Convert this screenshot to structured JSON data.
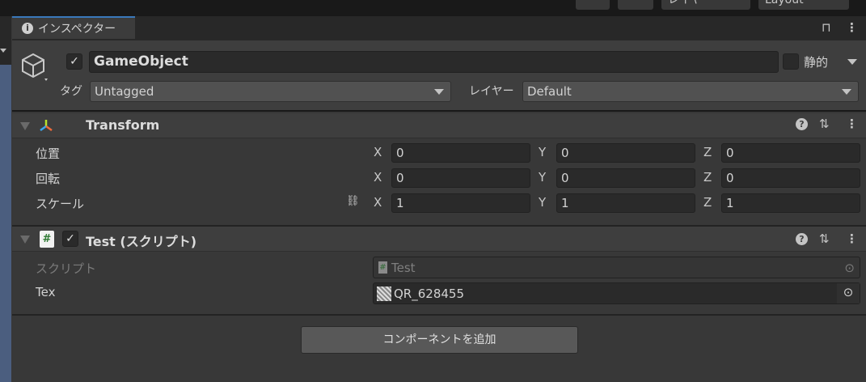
{
  "toolbar": {
    "layers": "レイヤー",
    "layout": "Layout"
  },
  "tab": {
    "label": "インスペクター"
  },
  "gameobject": {
    "name": "GameObject",
    "active": true,
    "static_label": "静的",
    "static": false,
    "tag_label": "タグ",
    "tag": "Untagged",
    "layer_label": "レイヤー",
    "layer": "Default"
  },
  "transform": {
    "title": "Transform",
    "rows": [
      {
        "label": "位置",
        "x": "0",
        "y": "0",
        "z": "0"
      },
      {
        "label": "回転",
        "x": "0",
        "y": "0",
        "z": "0"
      },
      {
        "label": "スケール",
        "x": "1",
        "y": "1",
        "z": "1"
      }
    ],
    "axes": {
      "x": "X",
      "y": "Y",
      "z": "Z"
    }
  },
  "script": {
    "title": "Test (スクリプト)",
    "enabled": true,
    "script_label": "スクリプト",
    "script_value": "Test",
    "tex_label": "Tex",
    "tex_value": "QR_628455"
  },
  "add_component": "コンポーネントを追加",
  "colors": {
    "accent": "#3a79bb",
    "panel": "#383838",
    "header": "#3e3e3e"
  }
}
